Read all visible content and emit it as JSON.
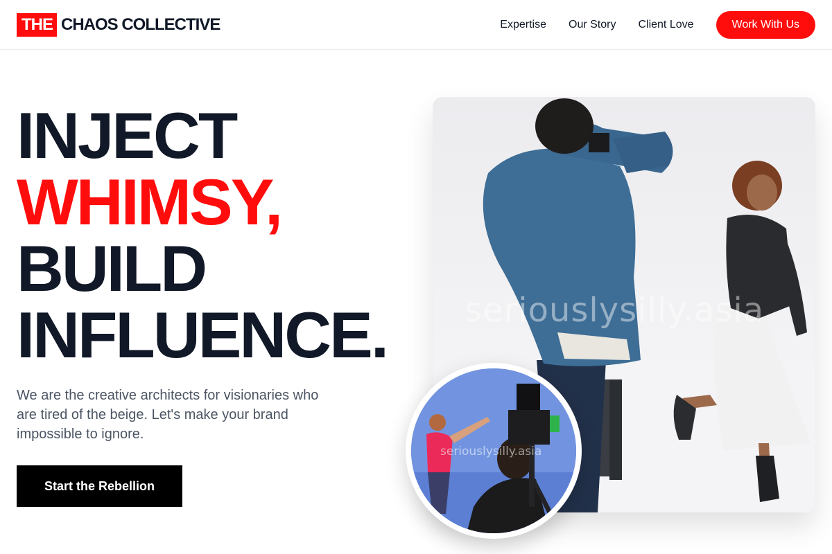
{
  "brand": {
    "logo_box": "THE",
    "logo_text": "CHAOS COLLECTIVE",
    "accent_color": "#ff0d0d"
  },
  "nav": {
    "links": [
      "Expertise",
      "Our Story",
      "Client Love"
    ],
    "cta_label": "Work With Us"
  },
  "hero": {
    "headline": [
      "INJECT",
      "WHIMSY,",
      "BUILD",
      "INFLUENCE."
    ],
    "tagline": "We are the creative architects for visionaries who are tired of the beige. Let's make your brand impossible to ignore.",
    "button_label": "Start the Rebellion",
    "main_image": {
      "description_icon": "photo-shoot-image",
      "watermark": "seriouslysilly.asia"
    },
    "inset_image": {
      "description_icon": "film-set-image",
      "watermark": "seriouslysilly.asia"
    }
  }
}
